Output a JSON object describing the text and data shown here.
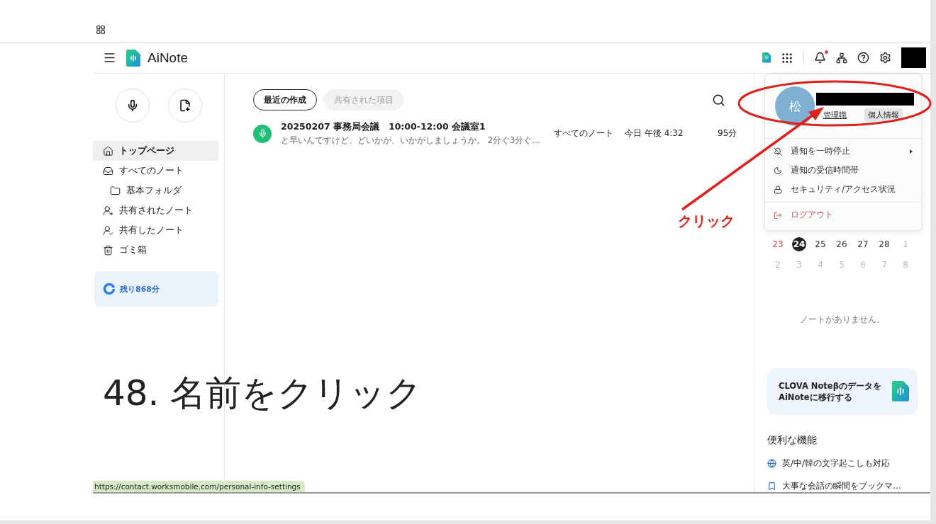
{
  "app": {
    "name": "AiNote"
  },
  "header": {
    "notification_unread": true
  },
  "sidebar": {
    "items": [
      {
        "label": "トップページ",
        "kind": "home",
        "selected": true
      },
      {
        "label": "すべてのノート",
        "kind": "inbox",
        "selected": false,
        "children": [
          {
            "label": "基本フォルダ",
            "kind": "folder",
            "selected": false
          }
        ]
      },
      {
        "label": "共有されたノート",
        "kind": "shared-in",
        "selected": false
      },
      {
        "label": "共有したノート",
        "kind": "shared-out",
        "selected": false
      },
      {
        "label": "ゴミ箱",
        "kind": "trash",
        "selected": false
      }
    ],
    "remaining": "残り868分"
  },
  "tabs": [
    {
      "label": "最近の作成",
      "selected": true
    },
    {
      "label": "共有された項目",
      "selected": false
    }
  ],
  "notes": [
    {
      "title": "20250207 事務局会議　10:00-12:00 会議室1",
      "snippet": "と早いんですけど、どいかが、いかがしましょうか。 2分ぐ3分ぐ…",
      "folder": "すべてのノート",
      "date": "今日 午後 4:32",
      "duration": "95分"
    }
  ],
  "profile_menu": {
    "avatar": "松",
    "role": "管理職",
    "tooltip": "個人情報",
    "items": [
      {
        "label": "通知を一時停止",
        "kind": "pause",
        "submenu": true
      },
      {
        "label": "通知の受信時間帯",
        "kind": "moon",
        "submenu": false
      },
      {
        "label": "セキュリティ/アクセス状況",
        "kind": "lock",
        "submenu": false
      }
    ],
    "logout": "ログアウト"
  },
  "calendar": {
    "rows": [
      [
        {
          "day": "23",
          "kind": "holiday",
          "selected": false
        },
        {
          "day": "24",
          "kind": "current",
          "selected": true
        },
        {
          "day": "25",
          "kind": "current",
          "selected": false
        },
        {
          "day": "26",
          "kind": "current",
          "selected": false
        },
        {
          "day": "27",
          "kind": "current",
          "selected": false
        },
        {
          "day": "28",
          "kind": "current",
          "selected": false
        },
        {
          "day": "1",
          "kind": "other",
          "selected": false
        }
      ],
      [
        {
          "day": "2",
          "kind": "other",
          "selected": false
        },
        {
          "day": "3",
          "kind": "other",
          "selected": false
        },
        {
          "day": "4",
          "kind": "other",
          "selected": false
        },
        {
          "day": "5",
          "kind": "other",
          "selected": false
        },
        {
          "day": "6",
          "kind": "other",
          "selected": false
        },
        {
          "day": "7",
          "kind": "other",
          "selected": false
        },
        {
          "day": "8",
          "kind": "other",
          "selected": false
        }
      ]
    ]
  },
  "empty_message": "ノートがありません。",
  "migration_card": {
    "lines": [
      "CLOVA Noteβのデータを",
      "AiNoteに移行する"
    ]
  },
  "features": {
    "title": "便利な機能",
    "items": [
      {
        "label": "英/中/韓の文字起こしも対応",
        "kind": "globe"
      },
      {
        "label": "大事な会話の瞬間をブックマ…",
        "kind": "bookmark"
      }
    ]
  },
  "status_url": "https://contact.worksmobile.com/personal-info-settings",
  "annotations": {
    "caption": "48. 名前をクリック",
    "callout": "クリック"
  }
}
